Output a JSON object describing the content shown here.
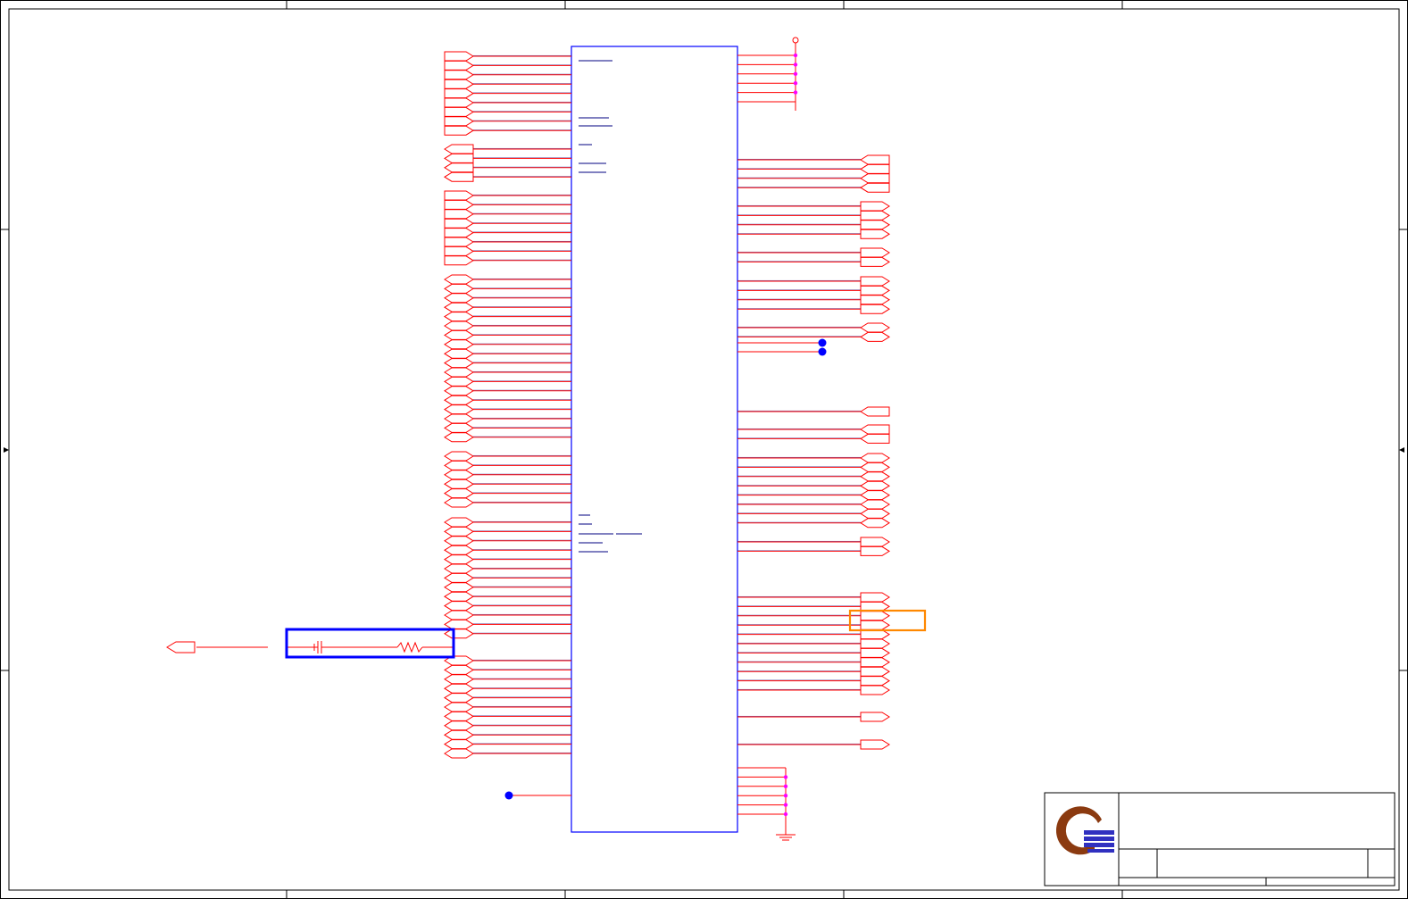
{
  "app": {
    "window_title": "",
    "document": ""
  },
  "colors": {
    "wire": "#ff0000",
    "net": "#000080",
    "ic_outline": "#0000ff",
    "junction_dot": "#ff00ff",
    "no_connect_dot": "#0000ff",
    "highlight_blue": "#0000ff",
    "highlight_orange": "#ff8800",
    "border": "#000000",
    "logo_brown": "#8b3a10",
    "logo_blue": "#3030c0"
  },
  "schematic": {
    "main_ic": {
      "name": "",
      "pins_left": 0,
      "pins_right": 0
    },
    "power_symbol": {
      "label": ""
    },
    "ground_symbol": {
      "label": ""
    },
    "off_page_connector_left": {
      "label": ""
    },
    "selected_part": {
      "label": "",
      "type": "resistor-capacitor-network"
    },
    "selected_port": {
      "label": ""
    }
  },
  "title_block": {
    "company": "",
    "title": "",
    "size": "",
    "document_number": "",
    "rev": "",
    "date": "",
    "sheet": ""
  },
  "icons": [
    "company-logo-icon",
    "ground-icon",
    "power-icon",
    "resistor-icon",
    "capacitor-icon",
    "arrow-left-icon",
    "arrow-right-icon"
  ]
}
